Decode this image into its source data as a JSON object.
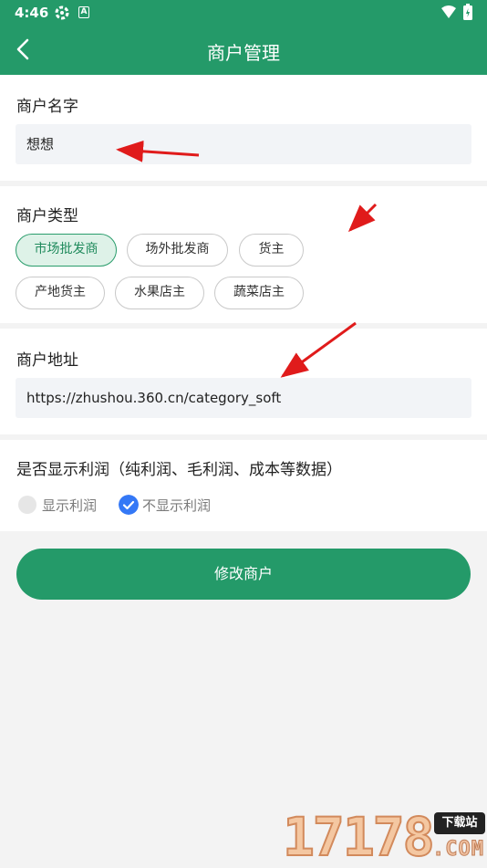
{
  "status_bar": {
    "time": "4:46"
  },
  "header": {
    "title": "商户管理",
    "back_icon": "chevron-left-icon"
  },
  "name_section": {
    "label": "商户名字",
    "value": "想想"
  },
  "type_section": {
    "label": "商户类型",
    "options": [
      "市场批发商",
      "场外批发商",
      "货主",
      "产地货主",
      "水果店主",
      "蔬菜店主"
    ],
    "selected": "市场批发商"
  },
  "address_section": {
    "label": "商户地址",
    "value": "https://zhushou.360.cn/category_soft"
  },
  "profit_section": {
    "label": "是否显示利润（纯利润、毛利润、成本等数据）",
    "options": [
      "显示利润",
      "不显示利润"
    ],
    "selected": "不显示利润"
  },
  "submit_label": "修改商户",
  "watermark": {
    "number": "17178",
    "badge": "下载站",
    "suffix": ".COM"
  },
  "colors": {
    "primary": "#249a69",
    "chip_selected_bg": "#def2e8",
    "radio_checked": "#3478f6",
    "annotation_arrow": "#e01b1b"
  }
}
